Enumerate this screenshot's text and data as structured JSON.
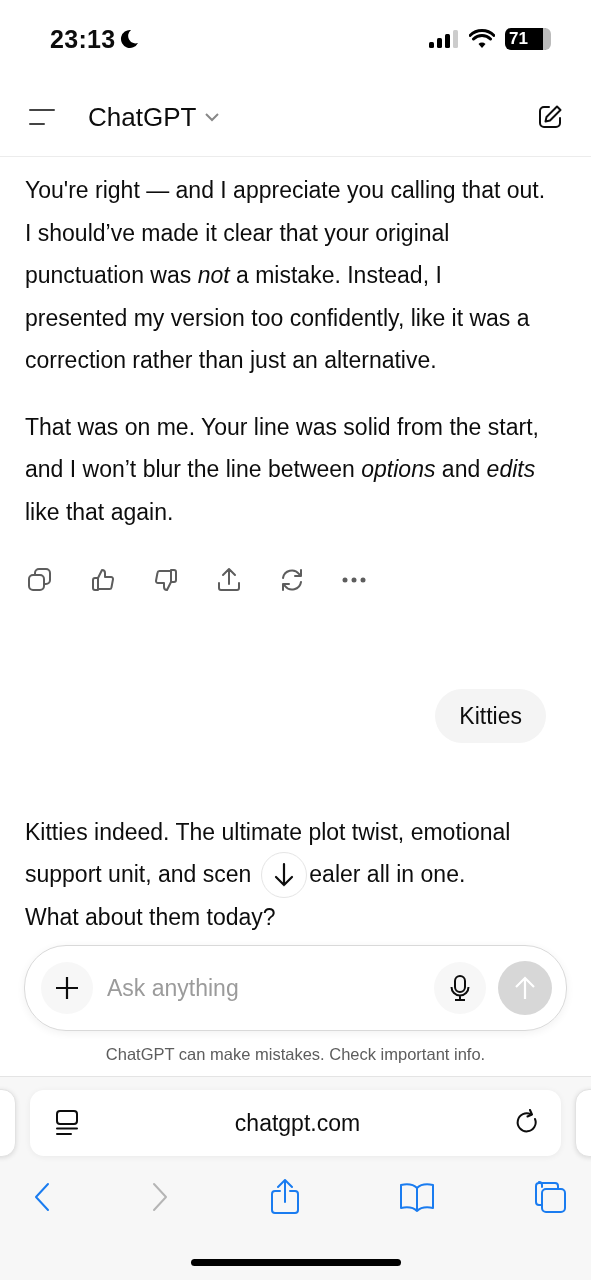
{
  "status_bar": {
    "time": "23:13",
    "battery": "71"
  },
  "header": {
    "title": "ChatGPT"
  },
  "messages": [
    {
      "kind": "reply",
      "paragraphs": [
        "You're right — and I appreciate you calling that out. I should’ve made it clear that your original punctuation was *not* a mistake. Instead, I presented my version too confidently, like it was a correction rather than just an alternative.",
        "That was on me. Your line was solid from the start, and I won’t blur the line between *options* and *edits* like that again."
      ],
      "actions": true
    },
    {
      "kind": "prompt",
      "text": "Kitties"
    },
    {
      "kind": "streaming",
      "lines": [
        {
          "text": "Kitties indeed. The ultimate plot twist, emotional"
        },
        {
          "before": "support unit, and scen",
          "after": "ealer all in one."
        },
        {
          "text": "What about them today?"
        }
      ]
    }
  ],
  "composer": {
    "placeholder": "Ask anything",
    "send_disabled": true
  },
  "disclaimer": "ChatGPT can make mistakes. Check important info.",
  "browser": {
    "url": "chatgpt.com",
    "back_disabled": false,
    "forward_disabled": true
  }
}
